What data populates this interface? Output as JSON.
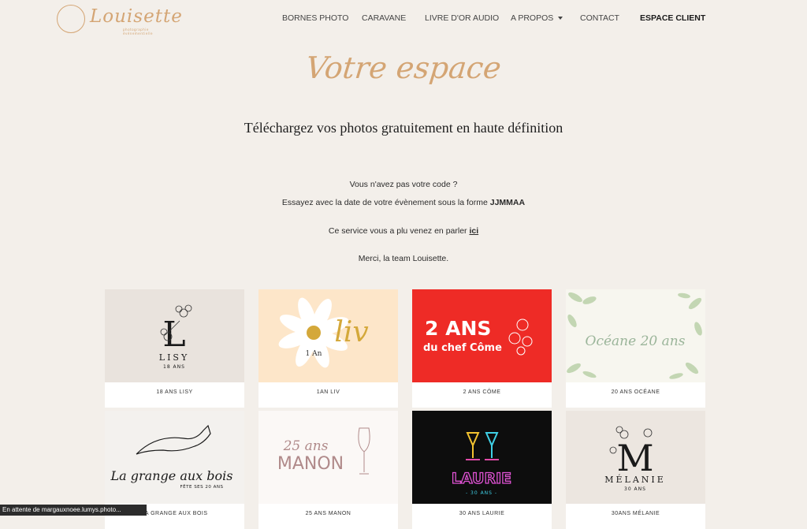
{
  "brand": {
    "name": "Louisette",
    "tagline": "photographie événementielle",
    "accent": "#d4a574"
  },
  "nav": {
    "items": [
      "BORNES PHOTO",
      "CARAVANE",
      "LIVRE D'OR AUDIO",
      "A PROPOS",
      "CONTACT",
      "ESPACE CLIENT"
    ]
  },
  "page": {
    "script_title": "Votre espace",
    "subtitle": "Téléchargez vos photos gratuitement en haute définition",
    "no_code": "Vous n'avez pas votre code ?",
    "try_prefix": "Essayez avec la date de votre évènement sous la forme ",
    "try_format": "JJMMAA",
    "service_prefix": "Ce service vous a plu venez en parler ",
    "service_link": "ici",
    "thanks": "Merci, la team Louisette."
  },
  "galleries": [
    {
      "caption": "18 ANS LISY",
      "art": {
        "main": "L",
        "name": "LISY",
        "sub": "18 ANS"
      },
      "bg": "#e9e3dd"
    },
    {
      "caption": "1AN LIV",
      "art": {
        "main": "liv",
        "sub": "1 An"
      },
      "bg": "#fde6c9"
    },
    {
      "caption": "2 ANS CÔME",
      "art": {
        "main": "2 ANS",
        "sub": "du chef Côme"
      },
      "bg": "#ee2b26"
    },
    {
      "caption": "20 ANS OCÉANE",
      "art": {
        "main": "Océane 20 ans"
      },
      "bg": "#f7f6ef"
    },
    {
      "caption": "LA GRANGE AUX BOIS",
      "art": {
        "main": "La grange aux bois",
        "sub": "FÊTE SES 20 ANS"
      },
      "bg": "#f3f1ee"
    },
    {
      "caption": "25 ANS MANON",
      "art": {
        "main": "MANON",
        "sub": "25 ans"
      },
      "bg": "#fbf8f6"
    },
    {
      "caption": "30 ANS LAURIE",
      "art": {
        "main": "LAURIE",
        "sub": "- 30 ANS -"
      },
      "bg": "#0d0d0d"
    },
    {
      "caption": "30ANS MÉLANIE",
      "art": {
        "main": "M",
        "name": "MÉLANIE",
        "sub": "30 ANS"
      },
      "bg": "#ece6e0"
    }
  ],
  "status_bar": "En attente de margauxnoee.lumys.photo..."
}
